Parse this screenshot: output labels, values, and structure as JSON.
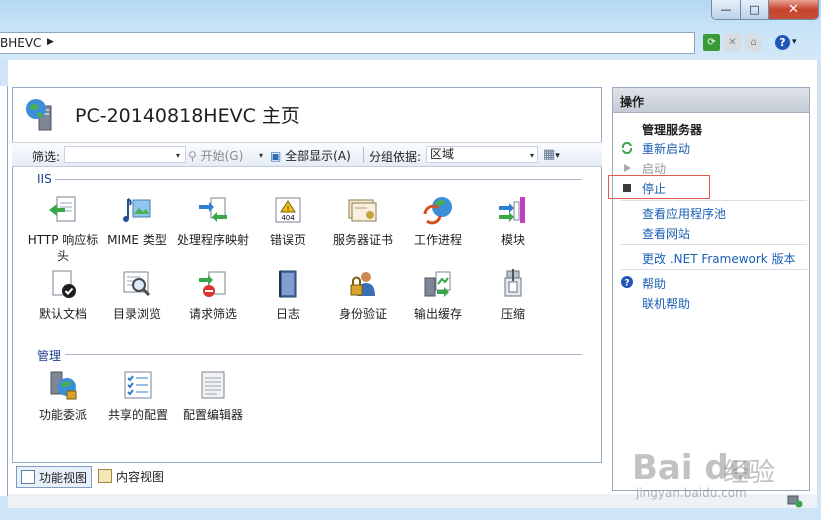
{
  "window": {
    "minimize_glyph": "—",
    "maximize_glyph": "□",
    "close_glyph": "✕"
  },
  "address": {
    "crumb": "BHEVC",
    "arrow": "▶"
  },
  "nav": {
    "refresh_icon": "refresh-icon",
    "stop_icon": "stop-icon",
    "home_icon": "home-icon",
    "help_glyph": "?",
    "help_arrow": "▾"
  },
  "page": {
    "title": "PC-20140818HEVC 主页"
  },
  "filterbar": {
    "filter_label": "筛选:",
    "filter_value": "",
    "start_label": "开始(G)",
    "show_all_label": "全部显示(A)",
    "group_by_label": "分组依据:",
    "group_by_value": "区域",
    "dropdown_glyph": "▾"
  },
  "sections": [
    {
      "title": "IIS",
      "items": [
        {
          "label": "HTTP 响应标头",
          "icon": "http-response-headers-icon"
        },
        {
          "label": "MIME 类型",
          "icon": "mime-types-icon"
        },
        {
          "label": "处理程序映射",
          "icon": "handler-mappings-icon"
        },
        {
          "label": "错误页",
          "icon": "error-pages-icon",
          "badge": "404"
        },
        {
          "label": "服务器证书",
          "icon": "server-certificates-icon"
        },
        {
          "label": "工作进程",
          "icon": "worker-processes-icon"
        },
        {
          "label": "模块",
          "icon": "modules-icon"
        },
        {
          "label": "默认文档",
          "icon": "default-document-icon"
        },
        {
          "label": "目录浏览",
          "icon": "directory-browsing-icon"
        },
        {
          "label": "请求筛选",
          "icon": "request-filtering-icon"
        },
        {
          "label": "日志",
          "icon": "logging-icon"
        },
        {
          "label": "身份验证",
          "icon": "authentication-icon"
        },
        {
          "label": "输出缓存",
          "icon": "output-caching-icon"
        },
        {
          "label": "压缩",
          "icon": "compression-icon"
        }
      ]
    },
    {
      "title": "管理",
      "items": [
        {
          "label": "功能委派",
          "icon": "feature-delegation-icon"
        },
        {
          "label": "共享的配置",
          "icon": "shared-configuration-icon"
        },
        {
          "label": "配置编辑器",
          "icon": "configuration-editor-icon"
        }
      ]
    }
  ],
  "view_tabs": [
    {
      "label": "功能视图",
      "active": true
    },
    {
      "label": "内容视图",
      "active": false
    }
  ],
  "actions": {
    "header": "操作",
    "manage_server_heading": "管理服务器",
    "restart": "重新启动",
    "start": "启动",
    "stop": "停止",
    "view_app_pools": "查看应用程序池",
    "view_sites": "查看网站",
    "change_net": "更改 .NET Framework 版本",
    "help": "帮助",
    "online_help": "联机帮助"
  },
  "watermark": {
    "brand": "Bai du",
    "cn": "经验",
    "url": "jingyan.baidu.com"
  },
  "colors": {
    "link": "#1a5fb4",
    "section_title": "#1f3f8f",
    "highlight_box": "#e05a50"
  }
}
